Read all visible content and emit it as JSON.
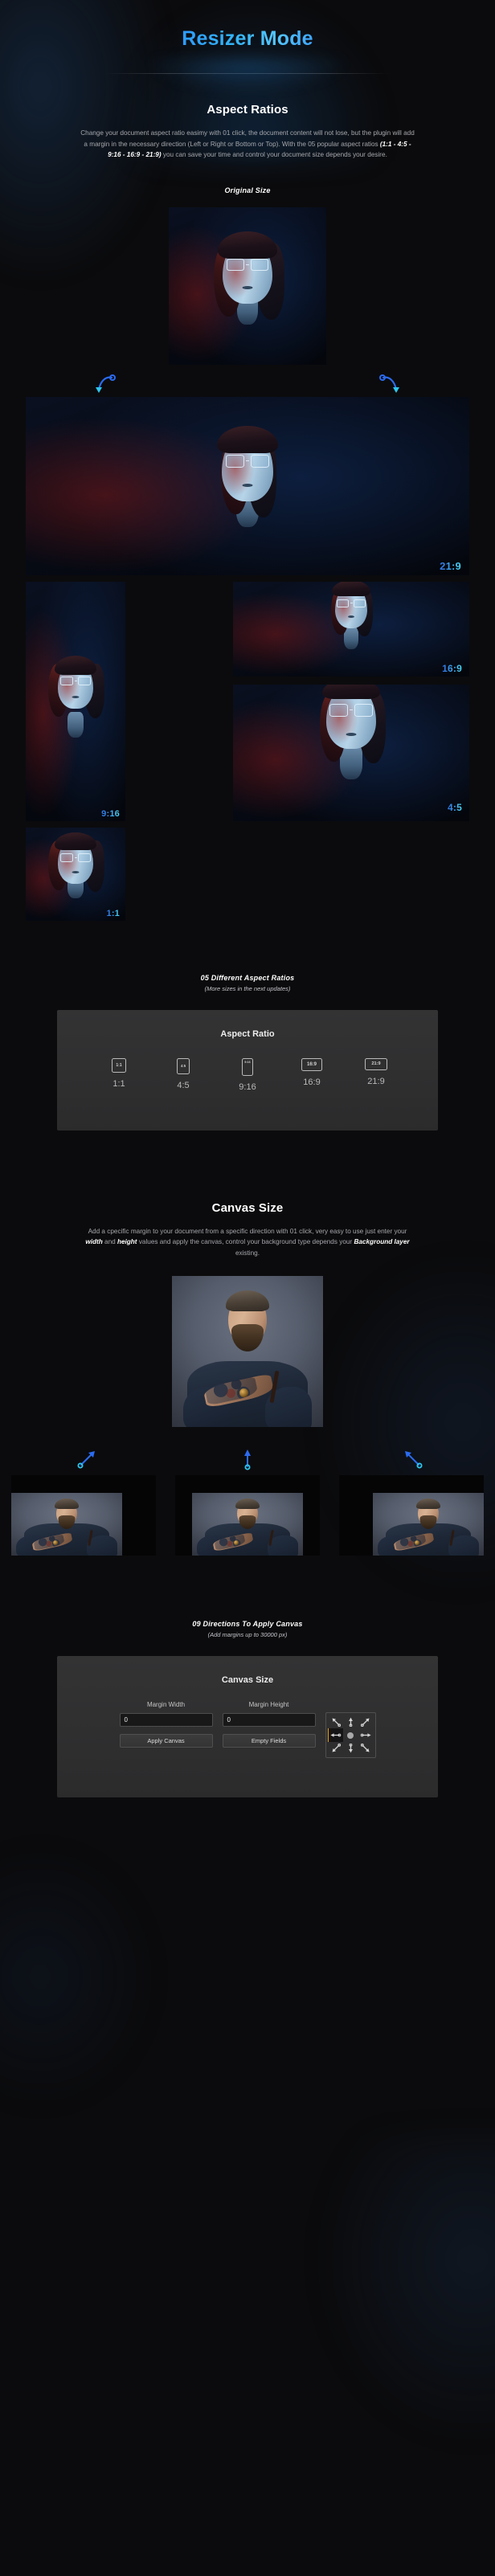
{
  "header": {
    "title": "Resizer Mode",
    "accent_from": "#2e9bff",
    "accent_to": "#49d6f0"
  },
  "aspect_section": {
    "heading": "Aspect Ratios",
    "description_part1": "Change your document aspect ratio easimy with 01 click, the document content will not lose, but the plugin will add a margin in the necessary direction (Left or Right or Bottom or Top). With the 05 popular aspect ratios ",
    "description_bold": "(1:1 - 4:5 - 9:16 - 16:9 - 21:9)",
    "description_part2": " you can save your time and control your document size depends your desire.",
    "original_label": "Original Size",
    "samples": [
      {
        "ratio": "21:9"
      },
      {
        "ratio": "9:16"
      },
      {
        "ratio": "16:9"
      },
      {
        "ratio": "4:5"
      },
      {
        "ratio": "1:1"
      }
    ],
    "feature_title": "05 Different Aspect Ratios",
    "feature_sub": "(More sizes in the next updates)"
  },
  "aspect_panel": {
    "title": "Aspect Ratio",
    "options": [
      {
        "label": "1:1",
        "icon_text": "1:1",
        "icon_name": "ratio-square-icon",
        "w": 15,
        "h": 15
      },
      {
        "label": "4:5",
        "icon_text": "4:5",
        "icon_name": "ratio-portrait-icon",
        "w": 14,
        "h": 17
      },
      {
        "label": "9:16",
        "icon_text": "9:16",
        "icon_name": "ratio-tall-icon",
        "w": 12,
        "h": 19
      },
      {
        "label": "16:9",
        "icon_text": "16:9",
        "icon_name": "ratio-wide-icon",
        "w": 22,
        "h": 14
      },
      {
        "label": "21:9",
        "icon_text": "21:9",
        "icon_name": "ratio-ultrawide-icon",
        "w": 24,
        "h": 13
      }
    ]
  },
  "canvas_section": {
    "heading": "Canvas Size",
    "description_part1": "Add a cpecific margin to your document from a specific direction with 01 click, very easy to use just enter your ",
    "description_bold1": "width",
    "description_mid1": " and ",
    "description_bold2": "height",
    "description_mid2": " values and apply the canvas, control your background type depends your ",
    "description_bold3": "Background layer",
    "description_part2": " existing.",
    "feature_title": "09 Directions To Apply Canvas",
    "feature_sub": "(Add margins up to 30000 px)"
  },
  "canvas_panel": {
    "title": "Canvas Size",
    "margin_width_label": "Margin Width",
    "margin_width_value": "0",
    "margin_height_label": "Margin Height",
    "margin_height_value": "0",
    "apply_button": "Apply Canvas",
    "empty_button": "Empty Fields",
    "directions": [
      {
        "name": "direction-up-left-icon",
        "glyph": "↖",
        "active": false
      },
      {
        "name": "direction-up-icon",
        "glyph": "↑",
        "active": false
      },
      {
        "name": "direction-up-right-icon",
        "glyph": "↗",
        "active": false
      },
      {
        "name": "direction-left-icon",
        "glyph": "←",
        "active": true
      },
      {
        "name": "direction-center-icon",
        "glyph": "●",
        "active": false
      },
      {
        "name": "direction-right-icon",
        "glyph": "→",
        "active": false
      },
      {
        "name": "direction-down-left-icon",
        "glyph": "↙",
        "active": false
      },
      {
        "name": "direction-down-icon",
        "glyph": "↓",
        "active": false
      },
      {
        "name": "direction-down-right-icon",
        "glyph": "↘",
        "active": false
      }
    ]
  }
}
